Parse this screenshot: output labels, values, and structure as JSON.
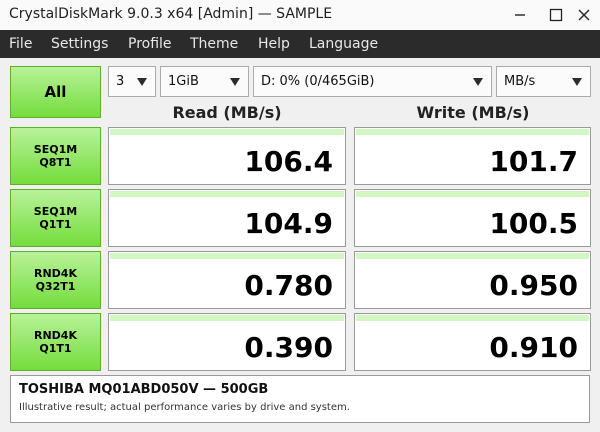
{
  "window": {
    "title": "CrystalDiskMark 9.0.3 x64 [Admin]  —  SAMPLE"
  },
  "menu": [
    "File",
    "Settings",
    "Profile",
    "Theme",
    "Help",
    "Language"
  ],
  "controls": {
    "all_label": "All",
    "count": "3",
    "size": "1GiB",
    "drive": "D: 0% (0/465GiB)",
    "unit": "MB/s"
  },
  "headers": {
    "read": "Read (MB/s)",
    "write": "Write (MB/s)"
  },
  "tests": [
    {
      "line1": "SEQ1M",
      "line2": "Q8T1",
      "read": "106.4",
      "write": "101.7"
    },
    {
      "line1": "SEQ1M",
      "line2": "Q1T1",
      "read": "104.9",
      "write": "100.5"
    },
    {
      "line1": "RND4K",
      "line2": "Q32T1",
      "read": "0.780",
      "write": "0.950"
    },
    {
      "line1": "RND4K",
      "line2": "Q1T1",
      "read": "0.390",
      "write": "0.910"
    }
  ],
  "footer": {
    "model": "TOSHIBA MQ01ABD050V — 500GB",
    "note": "Illustrative result; actual performance varies by drive and system."
  },
  "colors": {
    "button_top": "#b8f29a",
    "button_bottom": "#74dd3c",
    "bar": "#d3f7c3",
    "menubar": "#2b2b2b"
  }
}
